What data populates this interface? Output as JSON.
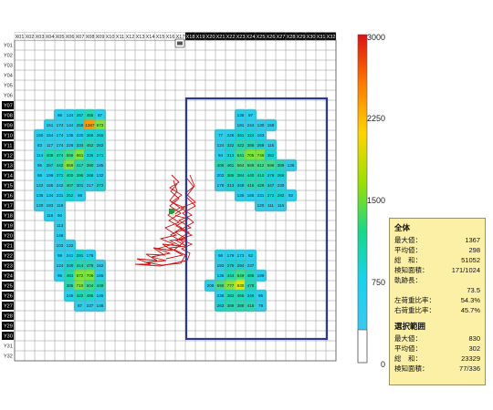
{
  "columns": [
    "X01",
    "X02",
    "X03",
    "X04",
    "X05",
    "X06",
    "X07",
    "X08",
    "X09",
    "X10",
    "X11",
    "X12",
    "X13",
    "X14",
    "X15",
    "X16",
    "X17",
    "X18",
    "X19",
    "X20",
    "X21",
    "X22",
    "X23",
    "X24",
    "X25",
    "X26",
    "X27",
    "X28",
    "X29",
    "X30",
    "X31",
    "X32"
  ],
  "rows": [
    "Y01",
    "Y02",
    "Y03",
    "Y04",
    "Y05",
    "Y06",
    "Y07",
    "Y08",
    "Y09",
    "Y10",
    "Y11",
    "Y12",
    "Y13",
    "Y14",
    "Y15",
    "Y16",
    "Y17",
    "Y18",
    "Y19",
    "Y20",
    "Y21",
    "Y22",
    "Y23",
    "Y24",
    "Y25",
    "Y26",
    "Y27",
    "Y28",
    "Y29",
    "Y30",
    "Y31",
    "Y32"
  ],
  "colorbar": {
    "ticks": [
      3000,
      2250,
      1500,
      750,
      0
    ],
    "colors": [
      "#dd1111",
      "#ff7a00",
      "#ffd400",
      "#9be000",
      "#16d88a",
      "#1ad2ee",
      "#39c8f0"
    ]
  },
  "selection_color": "#2b3a9a",
  "stats": {
    "overall_header": "全体",
    "rows": [
      {
        "label": "最大値：",
        "value": "1367"
      },
      {
        "label": "平均値：",
        "value": "298"
      },
      {
        "label": "総　和：",
        "value": "51052"
      },
      {
        "label": "検知面積：",
        "value": "171/1024"
      }
    ],
    "trajectory_label": "軌跡長：",
    "trajectory_value": "73.5",
    "left_ratio_label": "左荷重比率：",
    "left_ratio_value": "54.3%",
    "right_ratio_label": "右荷重比率：",
    "right_ratio_value": "45.7%",
    "selection_header": "選択範囲",
    "selection_rows": [
      {
        "label": "最大値：",
        "value": "830"
      },
      {
        "label": "平均値：",
        "value": "302"
      },
      {
        "label": "総　和：",
        "value": "23329"
      },
      {
        "label": "検知面積：",
        "value": "77/336"
      }
    ]
  },
  "cells": [
    {
      "c": 5,
      "r": 8,
      "v": "96"
    },
    {
      "c": 6,
      "r": 8,
      "v": "124"
    },
    {
      "c": 7,
      "r": 8,
      "v": "267"
    },
    {
      "c": 8,
      "r": 8,
      "v": "455"
    },
    {
      "c": 9,
      "r": 8,
      "v": "87"
    },
    {
      "c": 4,
      "r": 9,
      "v": "151"
    },
    {
      "c": 5,
      "r": 9,
      "v": "174"
    },
    {
      "c": 6,
      "r": 9,
      "v": "144"
    },
    {
      "c": 7,
      "r": 9,
      "v": "259"
    },
    {
      "c": 8,
      "r": 9,
      "v": "1367"
    },
    {
      "c": 9,
      "r": 9,
      "v": "673"
    },
    {
      "c": 3,
      "r": 10,
      "v": "150"
    },
    {
      "c": 4,
      "r": 10,
      "v": "154"
    },
    {
      "c": 5,
      "r": 10,
      "v": "174"
    },
    {
      "c": 6,
      "r": 10,
      "v": "135"
    },
    {
      "c": 7,
      "r": 10,
      "v": "220"
    },
    {
      "c": 8,
      "r": 10,
      "v": "368"
    },
    {
      "c": 9,
      "r": 10,
      "v": "265"
    },
    {
      "c": 3,
      "r": 11,
      "v": "83"
    },
    {
      "c": 4,
      "r": 11,
      "v": "117"
    },
    {
      "c": 5,
      "r": 11,
      "v": "174"
    },
    {
      "c": 6,
      "r": 11,
      "v": "226"
    },
    {
      "c": 7,
      "r": 11,
      "v": "334"
    },
    {
      "c": 8,
      "r": 11,
      "v": "462"
    },
    {
      "c": 9,
      "r": 11,
      "v": "262"
    },
    {
      "c": 3,
      "r": 12,
      "v": "114"
    },
    {
      "c": 4,
      "r": 12,
      "v": "408"
    },
    {
      "c": 5,
      "r": 12,
      "v": "474"
    },
    {
      "c": 6,
      "r": 12,
      "v": "556"
    },
    {
      "c": 7,
      "r": 12,
      "v": "661"
    },
    {
      "c": 8,
      "r": 12,
      "v": "335"
    },
    {
      "c": 9,
      "r": 12,
      "v": "271"
    },
    {
      "c": 3,
      "r": 13,
      "v": "95"
    },
    {
      "c": 4,
      "r": 13,
      "v": "267"
    },
    {
      "c": 5,
      "r": 13,
      "v": "442"
    },
    {
      "c": 6,
      "r": 13,
      "v": "659"
    },
    {
      "c": 7,
      "r": 13,
      "v": "417"
    },
    {
      "c": 8,
      "r": 13,
      "v": "390"
    },
    {
      "c": 9,
      "r": 13,
      "v": "185"
    },
    {
      "c": 3,
      "r": 14,
      "v": "86"
    },
    {
      "c": 4,
      "r": 14,
      "v": "199"
    },
    {
      "c": 5,
      "r": 14,
      "v": "372"
    },
    {
      "c": 6,
      "r": 14,
      "v": "400"
    },
    {
      "c": 7,
      "r": 14,
      "v": "395"
    },
    {
      "c": 8,
      "r": 14,
      "v": "268"
    },
    {
      "c": 9,
      "r": 14,
      "v": "132"
    },
    {
      "c": 3,
      "r": 15,
      "v": "122"
    },
    {
      "c": 4,
      "r": 15,
      "v": "165"
    },
    {
      "c": 5,
      "r": 15,
      "v": "242"
    },
    {
      "c": 6,
      "r": 15,
      "v": "407"
    },
    {
      "c": 7,
      "r": 15,
      "v": "301"
    },
    {
      "c": 8,
      "r": 15,
      "v": "217"
    },
    {
      "c": 9,
      "r": 15,
      "v": "272"
    },
    {
      "c": 3,
      "r": 16,
      "v": "135"
    },
    {
      "c": 4,
      "r": 16,
      "v": "134"
    },
    {
      "c": 5,
      "r": 16,
      "v": "231"
    },
    {
      "c": 6,
      "r": 16,
      "v": "252"
    },
    {
      "c": 7,
      "r": 16,
      "v": "96"
    },
    {
      "c": 3,
      "r": 17,
      "v": "120"
    },
    {
      "c": 4,
      "r": 17,
      "v": "183"
    },
    {
      "c": 5,
      "r": 17,
      "v": "118"
    },
    {
      "c": 4,
      "r": 18,
      "v": "116"
    },
    {
      "c": 5,
      "r": 18,
      "v": "90"
    },
    {
      "c": 5,
      "r": 19,
      "v": "113"
    },
    {
      "c": 5,
      "r": 20,
      "v": "146"
    },
    {
      "c": 5,
      "r": 21,
      "v": "103"
    },
    {
      "c": 6,
      "r": 21,
      "v": "122"
    },
    {
      "c": 5,
      "r": 22,
      "v": "99"
    },
    {
      "c": 6,
      "r": 22,
      "v": "241"
    },
    {
      "c": 7,
      "r": 22,
      "v": "291"
    },
    {
      "c": 8,
      "r": 22,
      "v": "176"
    },
    {
      "c": 5,
      "r": 23,
      "v": "124"
    },
    {
      "c": 6,
      "r": 23,
      "v": "340"
    },
    {
      "c": 7,
      "r": 23,
      "v": "414"
    },
    {
      "c": 8,
      "r": 23,
      "v": "476"
    },
    {
      "c": 9,
      "r": 23,
      "v": "152"
    },
    {
      "c": 5,
      "r": 24,
      "v": "95"
    },
    {
      "c": 6,
      "r": 24,
      "v": "483"
    },
    {
      "c": 7,
      "r": 24,
      "v": "672"
    },
    {
      "c": 8,
      "r": 24,
      "v": "706"
    },
    {
      "c": 9,
      "r": 24,
      "v": "165"
    },
    {
      "c": 6,
      "r": 25,
      "v": "385"
    },
    {
      "c": 7,
      "r": 25,
      "v": "710"
    },
    {
      "c": 8,
      "r": 25,
      "v": "504"
    },
    {
      "c": 9,
      "r": 25,
      "v": "449"
    },
    {
      "c": 6,
      "r": 26,
      "v": "245"
    },
    {
      "c": 7,
      "r": 26,
      "v": "422"
    },
    {
      "c": 8,
      "r": 26,
      "v": "486"
    },
    {
      "c": 9,
      "r": 26,
      "v": "145"
    },
    {
      "c": 7,
      "r": 27,
      "v": "87"
    },
    {
      "c": 8,
      "r": 27,
      "v": "237"
    },
    {
      "c": 9,
      "r": 27,
      "v": "148"
    },
    {
      "c": 23,
      "r": 8,
      "v": "136"
    },
    {
      "c": 24,
      "r": 8,
      "v": "97"
    },
    {
      "c": 23,
      "r": 9,
      "v": "191"
    },
    {
      "c": 24,
      "r": 9,
      "v": "244"
    },
    {
      "c": 25,
      "r": 9,
      "v": "130"
    },
    {
      "c": 26,
      "r": 9,
      "v": "159"
    },
    {
      "c": 21,
      "r": 10,
      "v": "77"
    },
    {
      "c": 22,
      "r": 10,
      "v": "226"
    },
    {
      "c": 23,
      "r": 10,
      "v": "361"
    },
    {
      "c": 24,
      "r": 10,
      "v": "324"
    },
    {
      "c": 25,
      "r": 10,
      "v": "153"
    },
    {
      "c": 21,
      "r": 11,
      "v": "124"
    },
    {
      "c": 22,
      "r": 11,
      "v": "322"
    },
    {
      "c": 23,
      "r": 11,
      "v": "422"
    },
    {
      "c": 24,
      "r": 11,
      "v": "386"
    },
    {
      "c": 25,
      "r": 11,
      "v": "269"
    },
    {
      "c": 26,
      "r": 11,
      "v": "115"
    },
    {
      "c": 21,
      "r": 12,
      "v": "94"
    },
    {
      "c": 22,
      "r": 12,
      "v": "313"
    },
    {
      "c": 23,
      "r": 12,
      "v": "541"
    },
    {
      "c": 24,
      "r": 12,
      "v": "705"
    },
    {
      "c": 25,
      "r": 12,
      "v": "746"
    },
    {
      "c": 26,
      "r": 12,
      "v": "352"
    },
    {
      "c": 21,
      "r": 13,
      "v": "406"
    },
    {
      "c": 22,
      "r": 13,
      "v": "461"
    },
    {
      "c": 23,
      "r": 13,
      "v": "564"
    },
    {
      "c": 24,
      "r": 13,
      "v": "569"
    },
    {
      "c": 25,
      "r": 13,
      "v": "612"
    },
    {
      "c": 26,
      "r": 13,
      "v": "596"
    },
    {
      "c": 27,
      "r": 13,
      "v": "389"
    },
    {
      "c": 28,
      "r": 13,
      "v": "136"
    },
    {
      "c": 21,
      "r": 14,
      "v": "203"
    },
    {
      "c": 22,
      "r": 14,
      "v": "385"
    },
    {
      "c": 23,
      "r": 14,
      "v": "384"
    },
    {
      "c": 24,
      "r": 14,
      "v": "440"
    },
    {
      "c": 25,
      "r": 14,
      "v": "410"
    },
    {
      "c": 26,
      "r": 14,
      "v": "378"
    },
    {
      "c": 27,
      "r": 14,
      "v": "266"
    },
    {
      "c": 21,
      "r": 15,
      "v": "178"
    },
    {
      "c": 22,
      "r": 15,
      "v": "313"
    },
    {
      "c": 23,
      "r": 15,
      "v": "349"
    },
    {
      "c": 24,
      "r": 15,
      "v": "415"
    },
    {
      "c": 25,
      "r": 15,
      "v": "429"
    },
    {
      "c": 26,
      "r": 15,
      "v": "347"
    },
    {
      "c": 27,
      "r": 15,
      "v": "230"
    },
    {
      "c": 23,
      "r": 16,
      "v": "135"
    },
    {
      "c": 24,
      "r": 16,
      "v": "165"
    },
    {
      "c": 25,
      "r": 16,
      "v": "231"
    },
    {
      "c": 26,
      "r": 16,
      "v": "272"
    },
    {
      "c": 27,
      "r": 16,
      "v": "292"
    },
    {
      "c": 28,
      "r": 16,
      "v": "92"
    },
    {
      "c": 25,
      "r": 17,
      "v": "120"
    },
    {
      "c": 26,
      "r": 17,
      "v": "111"
    },
    {
      "c": 27,
      "r": 17,
      "v": "116"
    },
    {
      "c": 21,
      "r": 22,
      "v": "96"
    },
    {
      "c": 22,
      "r": 22,
      "v": "179"
    },
    {
      "c": 23,
      "r": 22,
      "v": "173"
    },
    {
      "c": 24,
      "r": 22,
      "v": "62"
    },
    {
      "c": 21,
      "r": 23,
      "v": "193"
    },
    {
      "c": 22,
      "r": 23,
      "v": "275"
    },
    {
      "c": 23,
      "r": 23,
      "v": "294"
    },
    {
      "c": 24,
      "r": 23,
      "v": "237"
    },
    {
      "c": 21,
      "r": 24,
      "v": "136"
    },
    {
      "c": 22,
      "r": 24,
      "v": "444"
    },
    {
      "c": 23,
      "r": 24,
      "v": "649"
    },
    {
      "c": 24,
      "r": 24,
      "v": "486"
    },
    {
      "c": 25,
      "r": 24,
      "v": "199"
    },
    {
      "c": 20,
      "r": 25,
      "v": "209"
    },
    {
      "c": 21,
      "r": 25,
      "v": "590"
    },
    {
      "c": 22,
      "r": 25,
      "v": "777"
    },
    {
      "c": 23,
      "r": 25,
      "v": "830"
    },
    {
      "c": 24,
      "r": 25,
      "v": "478"
    },
    {
      "c": 21,
      "r": 26,
      "v": "238"
    },
    {
      "c": 22,
      "r": 26,
      "v": "383"
    },
    {
      "c": 23,
      "r": 26,
      "v": "466"
    },
    {
      "c": 24,
      "r": 26,
      "v": "349"
    },
    {
      "c": 25,
      "r": 26,
      "v": "95"
    },
    {
      "c": 21,
      "r": 27,
      "v": "263"
    },
    {
      "c": 22,
      "r": 27,
      "v": "389"
    },
    {
      "c": 23,
      "r": 27,
      "v": "388"
    },
    {
      "c": 24,
      "r": 27,
      "v": "418"
    },
    {
      "c": 25,
      "r": 27,
      "v": "79"
    }
  ]
}
